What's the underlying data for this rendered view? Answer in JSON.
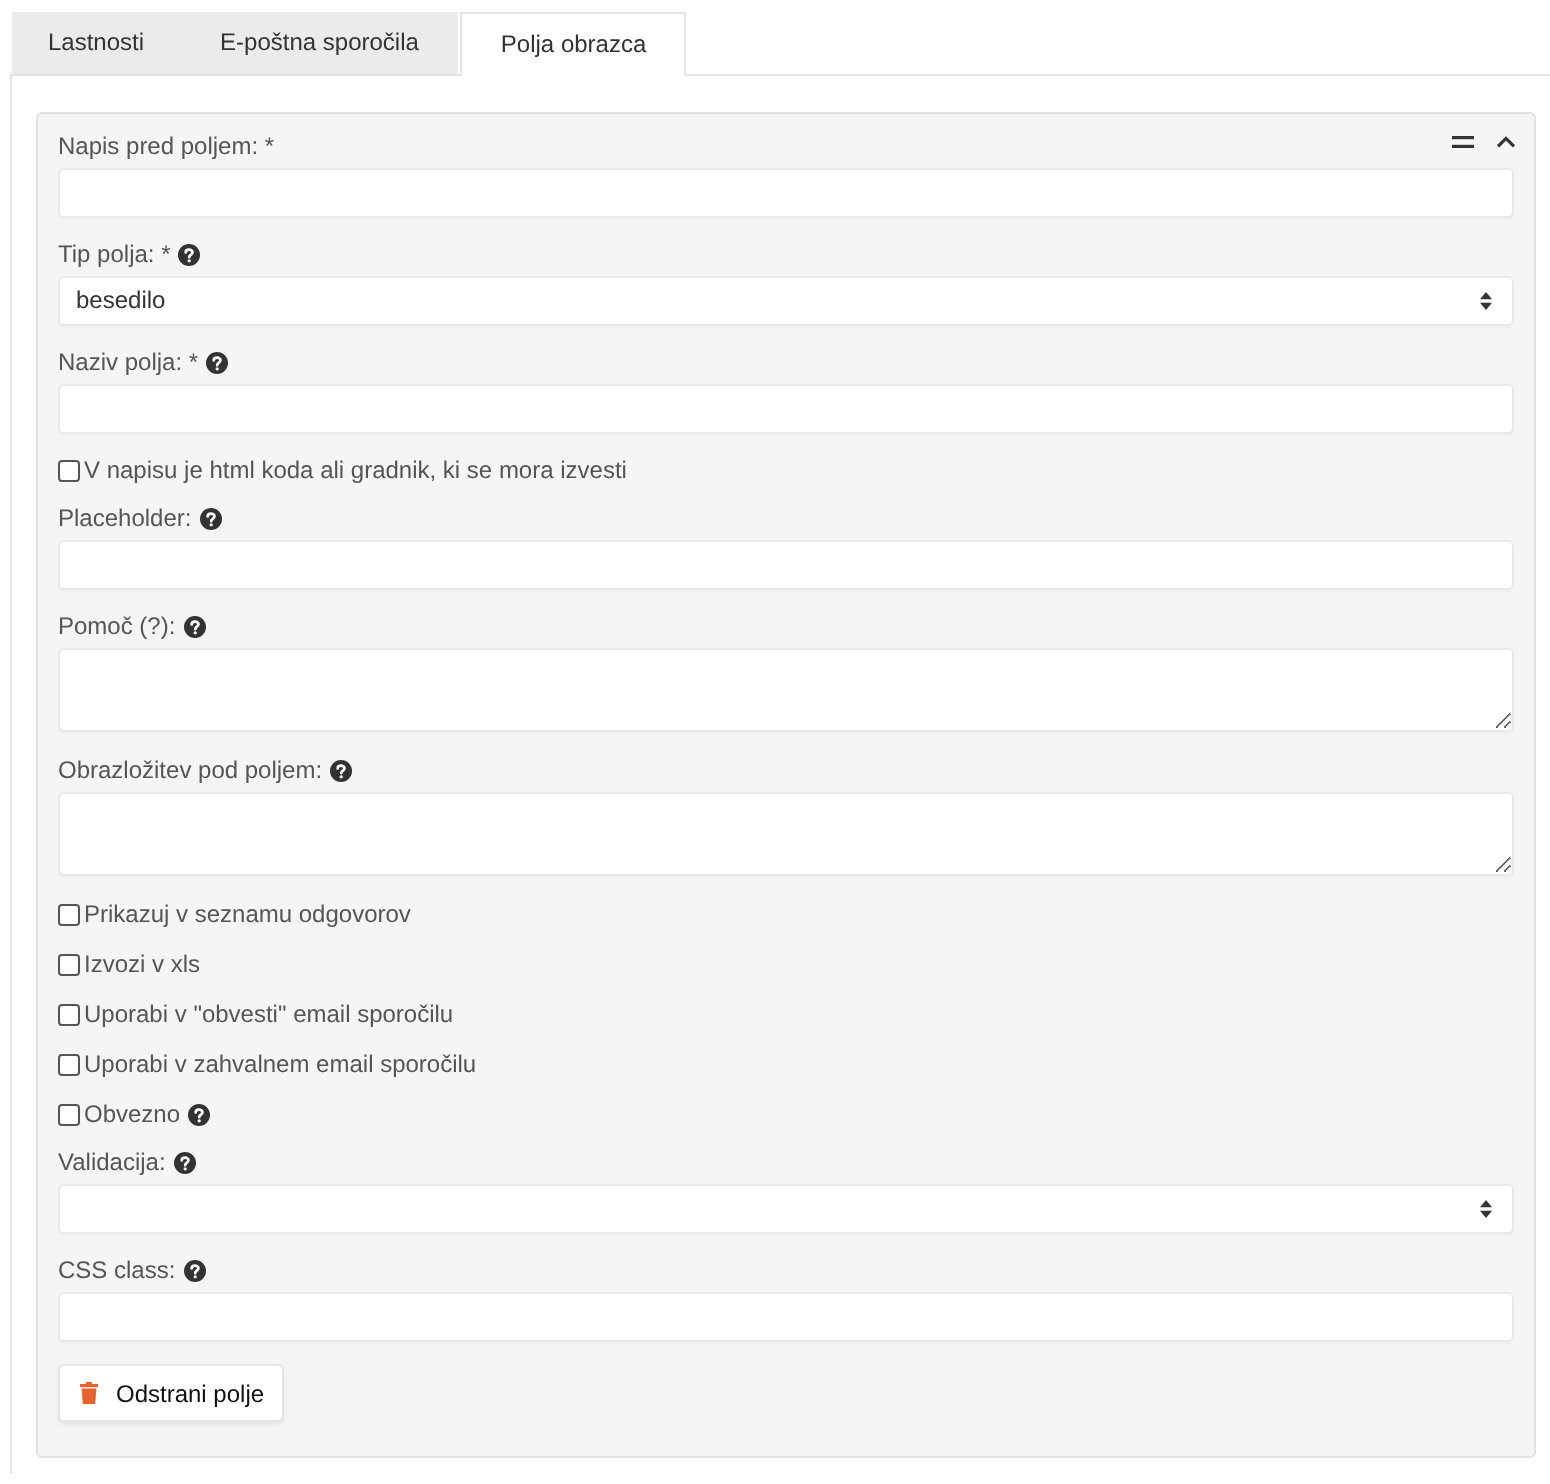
{
  "tabs": [
    {
      "label": "Lastnosti",
      "selected": false
    },
    {
      "label": "E-poštna sporočila",
      "selected": false
    },
    {
      "label": "Polja obrazca",
      "selected": true
    }
  ],
  "field_card": {
    "expanded": true,
    "rows": [
      {
        "kind": "text",
        "label": "Napis pred poljem: *",
        "help": false
      },
      {
        "kind": "select",
        "label": "Tip polja: *",
        "help": true,
        "value": "besedilo"
      },
      {
        "kind": "text",
        "label": "Naziv polja: *",
        "help": true
      },
      {
        "kind": "checkbox",
        "label": "V napisu je html koda ali gradnik, ki se mora izvesti",
        "checked": false,
        "help": false
      },
      {
        "kind": "text",
        "label": "Placeholder:",
        "help": true
      },
      {
        "kind": "textarea",
        "label": "Pomoč (?):",
        "help": true
      },
      {
        "kind": "textarea",
        "label": "Obrazložitev pod poljem:",
        "help": true
      },
      {
        "kind": "checkbox",
        "label": "Prikazuj v seznamu odgovorov",
        "checked": false,
        "help": false
      },
      {
        "kind": "checkbox",
        "label": "Izvozi v xls",
        "checked": false,
        "help": false
      },
      {
        "kind": "checkbox",
        "label": "Uporabi v \"obvesti\" email sporočilu",
        "checked": false,
        "help": false
      },
      {
        "kind": "checkbox",
        "label": "Uporabi v zahvalnem email sporočilu",
        "checked": false,
        "help": false
      },
      {
        "kind": "checkbox",
        "label": "Obvezno",
        "checked": false,
        "help": true
      },
      {
        "kind": "select",
        "label": "Validacija:",
        "help": true
      },
      {
        "kind": "text",
        "label": "CSS class:",
        "help": true
      }
    ],
    "remove_button": {
      "label": "Odstrani polje"
    }
  }
}
